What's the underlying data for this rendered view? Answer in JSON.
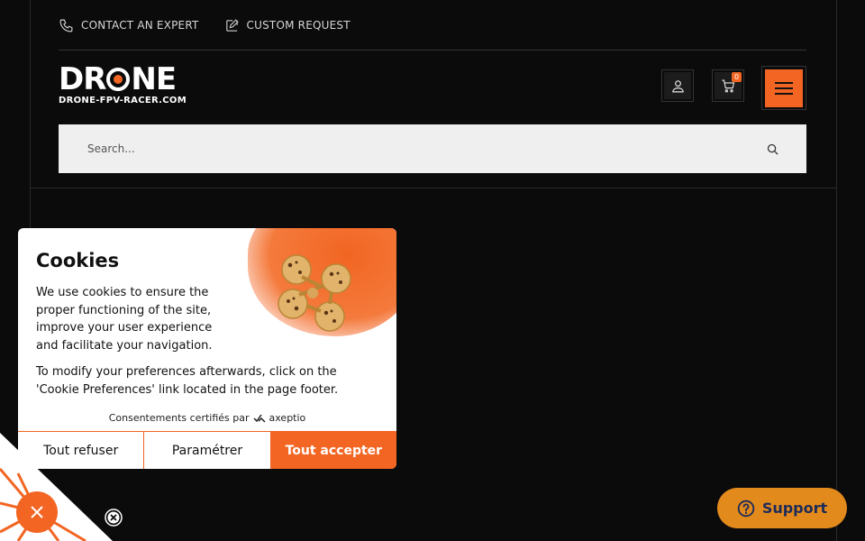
{
  "topbar": {
    "contact_label": "CONTACT AN EXPERT",
    "custom_label": "CUSTOM REQUEST"
  },
  "logo": {
    "word_left": "DR",
    "word_right": "NE",
    "subtitle": "DRONE-FPV-RACER.COM"
  },
  "header": {
    "cart_count": "0",
    "search_placeholder": "Search..."
  },
  "cookie_modal": {
    "title": "Cookies",
    "intro": "We use cookies to ensure the proper functioning of the site, improve your user experience and facilitate your navigation.",
    "preferences_text": "To modify your preferences afterwards, click on the 'Cookie Preferences' link located in the page footer.",
    "certified_text": "Consentements certifiés par",
    "certified_brand": "axeptio",
    "refuse_label": "Tout refuser",
    "settings_label": "Paramétrer",
    "accept_label": "Tout accepter"
  },
  "support": {
    "label": "Support"
  },
  "colors": {
    "accent": "#f26522",
    "background": "#0b0b0c",
    "support_bg": "#e38a1d",
    "support_text": "#1d2b57"
  }
}
